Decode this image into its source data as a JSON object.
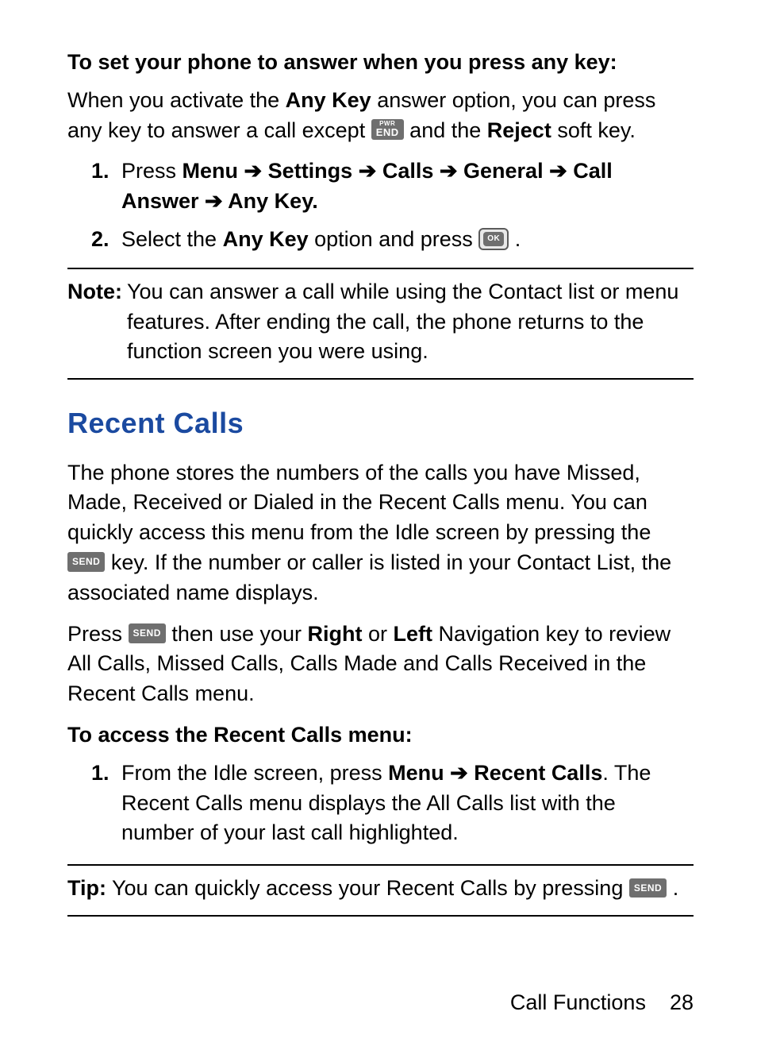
{
  "sec1": {
    "subhead": "To set your phone to answer when you press any key:",
    "para1_a": "When you activate the ",
    "para1_b_bold": "Any Key",
    "para1_c": " answer option, you can press any key to answer a call except ",
    "para1_d": " and the ",
    "para1_e_bold": "Reject",
    "para1_f": " soft key.",
    "step1_num": "1.",
    "step1_a": "Press ",
    "step1_menu": "Menu",
    "step1_arr": " ➔ ",
    "step1_settings": "Settings",
    "step1_calls": "Calls",
    "step1_general": "General",
    "step1_callanswer": "Call Answer",
    "step1_anykey": "Any Key.",
    "step2_num": "2.",
    "step2_a": "Select the ",
    "step2_b_bold": "Any Key",
    "step2_c": " option and press ",
    "step2_d": "."
  },
  "note": {
    "label": "Note:",
    "body": "You can answer a call while using the Contact list or menu features. After ending the call, the phone returns to the function screen you were using."
  },
  "sec2": {
    "title": "Recent Calls",
    "para1_a": "The phone stores the numbers of the calls you have Missed, Made, Received or Dialed in the Recent Calls menu. You can quickly access this menu from the Idle screen by pressing the ",
    "para1_b": " key. If the number or caller is listed in your Contact List, the associated name displays.",
    "para2_a": "Press ",
    "para2_b": " then use your ",
    "para2_right": "Right",
    "para2_or": " or ",
    "para2_left": "Left",
    "para2_c": " Navigation key to review All Calls, Missed Calls, Calls Made and Calls Received in the Recent Calls menu.",
    "subhead": "To access the Recent Calls menu:",
    "step1_num": "1.",
    "step1_a": "From the Idle screen, press ",
    "step1_menu": "Menu",
    "step1_arr": " ➔ ",
    "step1_recent": "Recent Calls",
    "step1_b": ". The Recent Calls menu displays the All Calls list with the number of your last call highlighted."
  },
  "tip": {
    "label": "Tip:",
    "body_a": " You can quickly access your Recent Calls by pressing ",
    "body_b": "."
  },
  "keys": {
    "end_pwr": "PWR",
    "end_end": "END",
    "ok": "OK",
    "send": "SEND"
  },
  "footer": {
    "section": "Call Functions",
    "page": "28"
  }
}
